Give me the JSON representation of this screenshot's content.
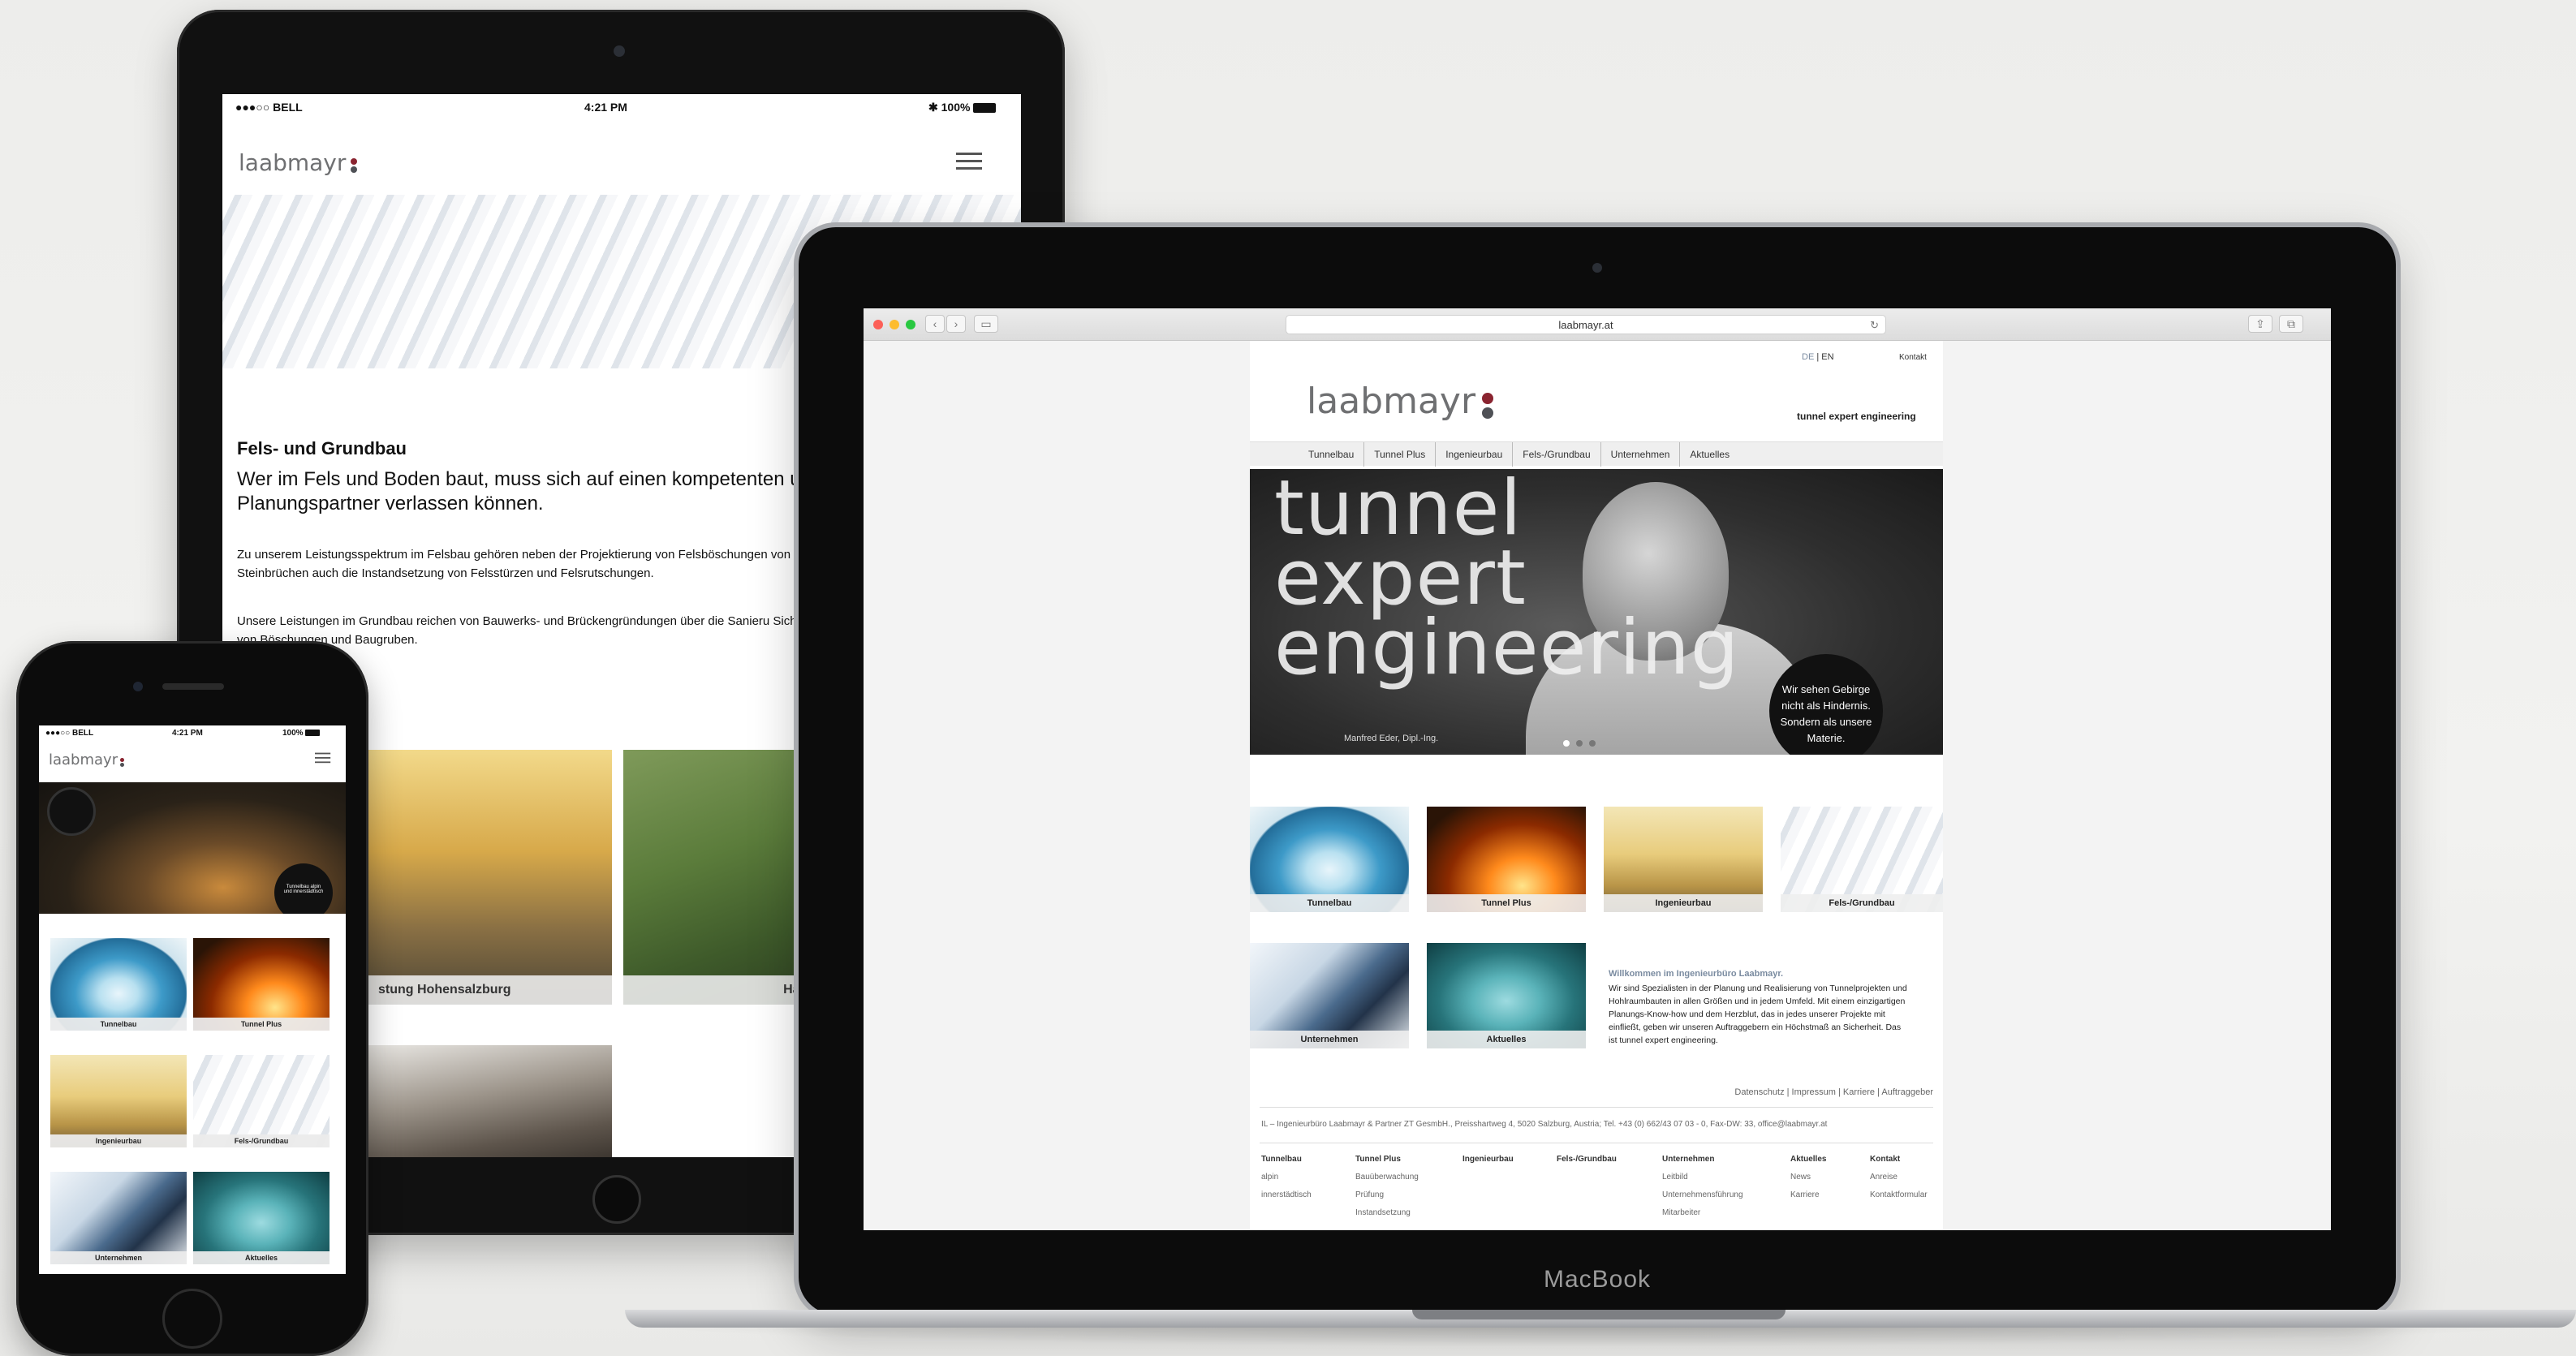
{
  "tablet": {
    "status": {
      "carrier": "●●●○○ BELL",
      "time": "4:21 PM",
      "battery": "100%"
    },
    "logo": "laabmayr",
    "heading": "Fels- und Grundbau",
    "subheading": "Wer im Fels und Boden baut, muss sich auf einen kompetenten u Planungspartner verlassen können.",
    "paragraph1": "Zu unserem Leistungsspektrum im Felsbau gehören neben der Projektierung von Felsböschungen von Steinbrüchen auch die Instandsetzung von Felsstürzen und Felsrutschungen.",
    "paragraph2": "Unsere Leistungen im Grundbau reichen von Bauwerks- und Brückengründungen über die Sanieru Sicherung von Böschungen und Baugruben.",
    "tiles": [
      {
        "label": "stung Hohensalzburg"
      },
      {
        "label": "Hangrutsch"
      }
    ]
  },
  "laptop": {
    "brand": "MacBook",
    "url": "laabmayr.at",
    "site": {
      "lang_de": "DE",
      "lang_sep": "|",
      "lang_en": "EN",
      "contact": "Kontakt",
      "logo": "laabmayr",
      "tagline": "tunnel expert engineering",
      "nav": [
        "Tunnelbau",
        "Tunnel Plus",
        "Ingenieurbau",
        "Fels-/Grundbau",
        "Unternehmen",
        "Aktuelles"
      ],
      "hero": {
        "words": [
          "tunnel",
          "expert",
          "engineering"
        ],
        "caption": "Manfred Eder, Dipl.-Ing.",
        "bubble": [
          "Wir sehen Gebirge",
          "nicht als Hindernis.",
          "Sondern als unsere",
          "Materie."
        ]
      },
      "tiles": [
        {
          "label": "Tunnelbau"
        },
        {
          "label": "Tunnel Plus"
        },
        {
          "label": "Ingenieurbau"
        },
        {
          "label": "Fels-/Grundbau"
        },
        {
          "label": "Unternehmen"
        },
        {
          "label": "Aktuelles"
        }
      ],
      "welcome": {
        "title": "Willkommen im Ingenieurbüro Laabmayr.",
        "text": "Wir sind Spezialisten in der Planung und Realisierung von Tunnelprojekten und Hohlraumbauten in allen Größen und in jedem Umfeld. Mit einem einzigartigen Planungs-Know-how und dem Herzblut, das in jedes unserer Projekte mit einfließt, geben wir unseren Auftraggebern ein Höchstmaß an Sicherheit. Das ist tunnel expert engineering."
      },
      "links": "Datenschutz | Impressum | Karriere | Auftraggeber",
      "address": "IL – Ingenieurbüro Laabmayr  &  Partner ZT GesmbH.,  Preisshartweg 4,  5020 Salzburg,  Austria;  Tel.  +43 (0) 662/43 07 03 - 0, Fax-DW: 33,    office@laabmayr.at",
      "footer": [
        {
          "title": "Tunnelbau",
          "items": [
            "alpin",
            "innerstädtisch"
          ]
        },
        {
          "title": "Tunnel Plus",
          "items": [
            "Bauüberwachung",
            "Prüfung",
            "Instandsetzung"
          ]
        },
        {
          "title": "Ingenieurbau",
          "items": []
        },
        {
          "title": "Fels-/Grundbau",
          "items": []
        },
        {
          "title": "Unternehmen",
          "items": [
            "Leitbild",
            "Unternehmensführung",
            "Mitarbeiter"
          ]
        },
        {
          "title": "Aktuelles",
          "items": [
            "News",
            "Karriere"
          ]
        },
        {
          "title": "Kontakt",
          "items": [
            "Anreise",
            "Kontaktformular"
          ]
        }
      ]
    }
  },
  "phone": {
    "status": {
      "carrier": "●●●○○ BELL",
      "time": "4:21 PM",
      "battery": "100%"
    },
    "logo": "laabmayr",
    "hero_bubble": [
      "Tunnelbau alpin",
      "und innerstädtisch"
    ],
    "tiles": [
      {
        "label": "Tunnelbau"
      },
      {
        "label": "Tunnel Plus"
      },
      {
        "label": "Ingenieurbau"
      },
      {
        "label": "Fels-/Grundbau"
      },
      {
        "label": "Unternehmen"
      },
      {
        "label": "Aktuelles"
      }
    ]
  },
  "colors": {
    "logo_red": "#8a2430",
    "logo_grey": "#4f5156",
    "accent_blue": "#7a8ba0"
  }
}
